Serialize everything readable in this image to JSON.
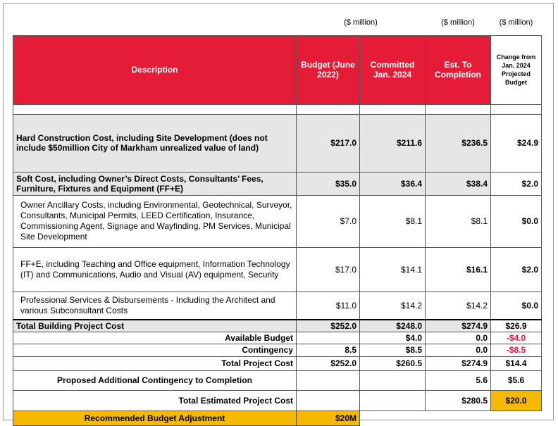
{
  "units": {
    "budget": "($ million)",
    "est": "($ million)",
    "change": "($ million)"
  },
  "headers": {
    "description": "Description",
    "budget": "Budget (June 2022)",
    "committed": "Committed Jan. 2024",
    "est": "Est. To Completion",
    "change": "Change from Jan. 2024 Projected Budget"
  },
  "rows": {
    "hard": {
      "desc": "Hard Construction Cost, including Site Development      (does not include $50million City of Markham unrealized value of land)",
      "budget": "$217.0",
      "committed": "$211.6",
      "est": "$236.5",
      "change": "$24.9"
    },
    "soft": {
      "desc": "Soft Cost, including Owner’s Direct Costs, Consultants’ Fees, Furniture, Fixtures and Equipment (FF+E)",
      "budget": "$35.0",
      "committed": "$36.4",
      "est": "$38.4",
      "change": "$2.0"
    },
    "owner": {
      "desc": "Owner Ancillary Costs, including Environmental, Geotechnical, Surveyor, Consultants, Municipal Permits, LEED Certification, Insurance, Commissioning Agent, Signage and Wayfinding, PM Services, Municipal Site Development",
      "budget": "$7.0",
      "committed": "$8.1",
      "est": "$8.1",
      "change": "$0.0"
    },
    "ffe": {
      "desc": "FF+E, including Teaching and Office equipment, Information Technology (IT) and Communications, Audio and Visual (AV) equipment, Security",
      "budget": "$17.0",
      "committed": "$14.1",
      "est": "$16.1",
      "change": "$2.0"
    },
    "prof": {
      "desc": "Professional Services & Disbursements - Including the Architect and various Subconsultant Costs",
      "budget": "$11.0",
      "committed": "$14.2",
      "est": "$14.2",
      "change": "$0.0"
    },
    "total_building": {
      "desc": "Total Building Project Cost",
      "budget": "$252.0",
      "committed": "$248.0",
      "est": "$274.9",
      "change": "$26.9"
    },
    "available": {
      "desc": "Available Budget",
      "budget": "",
      "committed": "$4.0",
      "est": "0.0",
      "change": "-$4.0"
    },
    "contingency": {
      "desc": "Contingency",
      "budget": "8.5",
      "committed": "$8.5",
      "est": "0.0",
      "change": "-$8.5"
    },
    "total_project": {
      "desc": "Total Project Cost",
      "budget": "$252.0",
      "committed": "$260.5",
      "est": "$274.9",
      "change": "$14.4"
    },
    "proposed": {
      "desc": "Proposed Additional Contingency to Completion",
      "budget": "",
      "committed": "",
      "est": "5.6",
      "change": "$5.6"
    },
    "total_estimated": {
      "desc": "Total Estimated Project Cost",
      "budget": "",
      "committed": "",
      "est": "$280.5",
      "change": "$20.0"
    },
    "recommended": {
      "desc": "Recommended Budget Adjustment",
      "budget": "$20M"
    }
  },
  "colors": {
    "header_red": "#e41c38",
    "highlight_gold": "#f6b800",
    "row_gray": "#e6e6e6"
  }
}
